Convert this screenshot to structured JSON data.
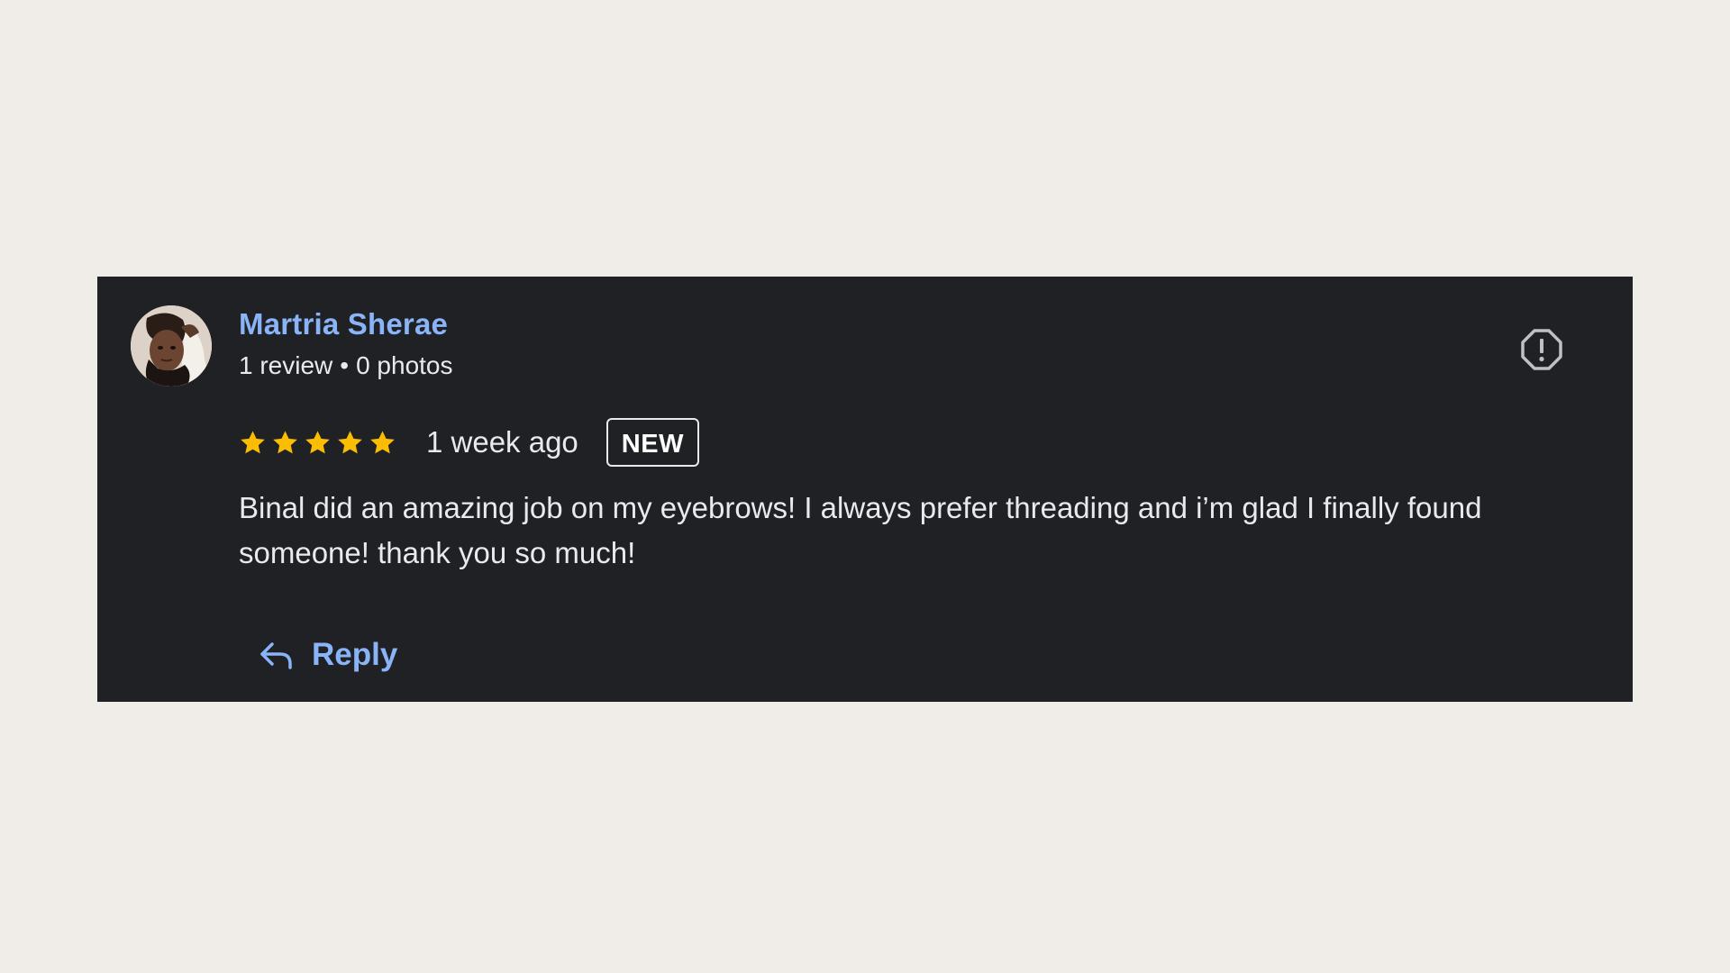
{
  "review": {
    "author": {
      "name": "Martria Sherae",
      "review_count": "1 review",
      "separator": "•",
      "photo_count": "0 photos"
    },
    "rating": {
      "stars": 5,
      "max": 5,
      "star_color": "#fbbc04"
    },
    "timestamp": "1 week ago",
    "badge": "NEW",
    "text": "Binal did an amazing job on my eyebrows! I always prefer threading and i’m glad I finally found someone! thank you so much!",
    "actions": {
      "reply_label": "Reply"
    },
    "icons": {
      "report": "report-flag-icon",
      "reply": "reply-arrow-icon",
      "star": "star-icon"
    }
  },
  "colors": {
    "page_background": "#f0ede8",
    "card_background": "#202124",
    "accent": "#8ab4f8",
    "text": "#e8eaed"
  }
}
